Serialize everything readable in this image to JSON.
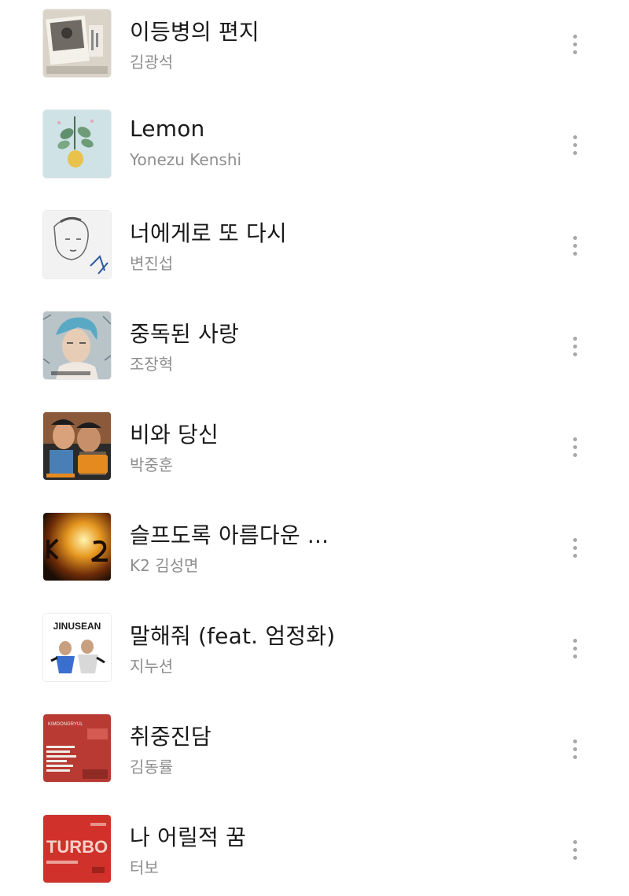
{
  "songs": [
    {
      "title": "이등병의 편지",
      "artist": "김광석",
      "cover_icon": "polaroid-photo-cover",
      "cover_colors": [
        "#d9d3c8",
        "#6f6a63"
      ]
    },
    {
      "title": "Lemon",
      "artist": "Yonezu Kenshi",
      "cover_icon": "lemon-branch-cover",
      "cover_colors": [
        "#cfe2e6",
        "#e9c24c"
      ]
    },
    {
      "title": "너에게로 또 다시",
      "artist": "변진섭",
      "cover_icon": "pencil-portrait-cover",
      "cover_colors": [
        "#f2f2f2",
        "#555555"
      ]
    },
    {
      "title": "중독된 사랑",
      "artist": "조장혁",
      "cover_icon": "illustrated-portrait-cover",
      "cover_colors": [
        "#d8dde0",
        "#5aa9c4"
      ]
    },
    {
      "title": "비와 당신",
      "artist": "박중훈",
      "cover_icon": "radio-star-cover",
      "cover_colors": [
        "#2a2a2a",
        "#e58a1f"
      ]
    },
    {
      "title": "슬프도록 아름다운 ...",
      "artist": "K2 김성면",
      "cover_icon": "k2-flame-cover",
      "cover_colors": [
        "#1a0d05",
        "#e89a22"
      ]
    },
    {
      "title": "말해줘 (feat. 엄정화)",
      "artist": "지누션",
      "cover_icon": "jinusean-cover",
      "cover_colors": [
        "#ffffff",
        "#1a1a1a"
      ],
      "cover_text": "JINUSEAN"
    },
    {
      "title": "취중진담",
      "artist": "김동률",
      "cover_icon": "red-newspaper-cover",
      "cover_colors": [
        "#b83a33",
        "#f0ece6"
      ],
      "cover_text": "KIMDONGRYUL"
    },
    {
      "title": "나 어릴적 꿈",
      "artist": "터보",
      "cover_icon": "turbo-red-cover",
      "cover_colors": [
        "#d0322b",
        "#f6d0c8"
      ],
      "cover_text": "TURBO"
    }
  ],
  "more_icon": "more-vertical-icon"
}
